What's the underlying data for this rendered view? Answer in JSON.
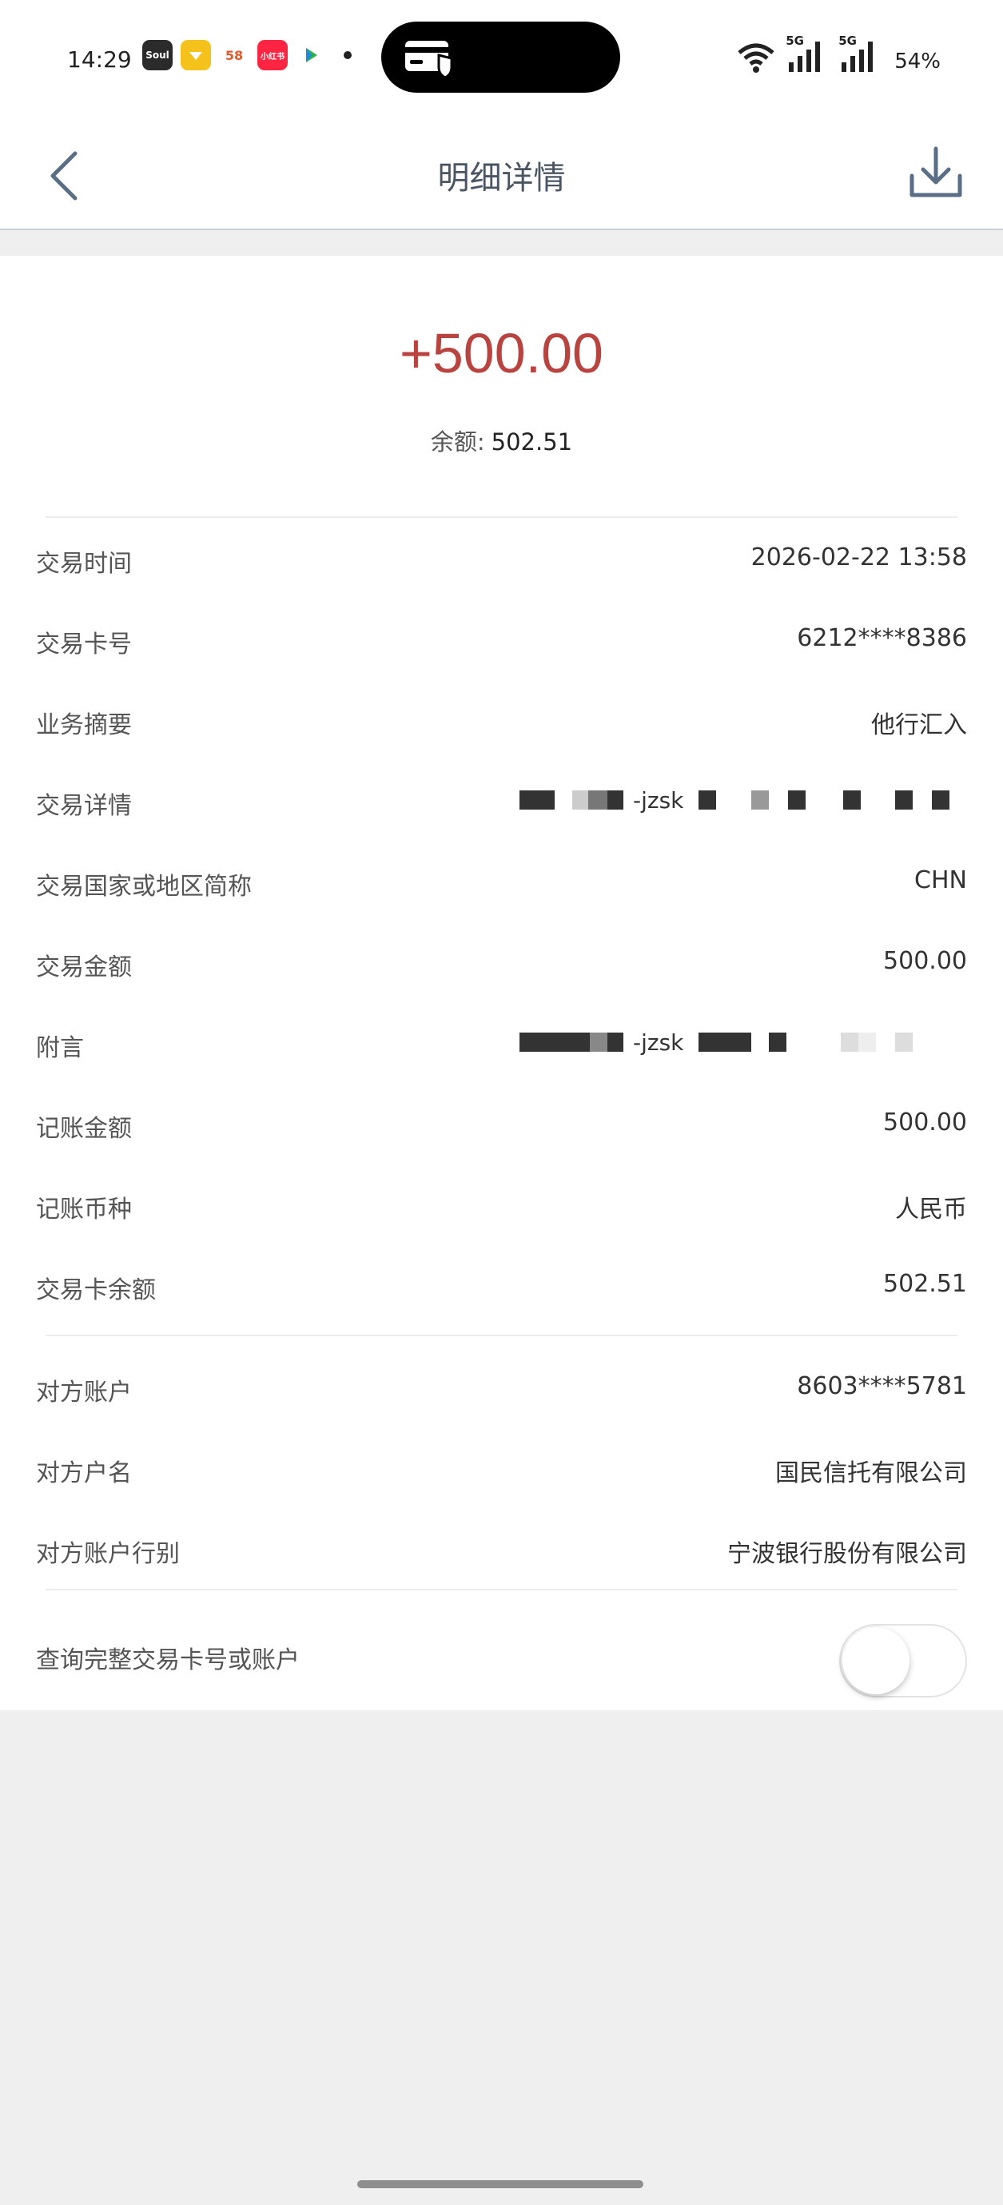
{
  "status_bar": {
    "time": "14:29",
    "notification_apps": [
      "Soul",
      "",
      "58",
      "小红书",
      ""
    ],
    "battery": "54%",
    "network_badges": [
      "5G",
      "5G"
    ]
  },
  "nav": {
    "title": "明细详情"
  },
  "summary": {
    "amount": "+500.00",
    "balance_label": "余额:",
    "balance_value": "502.51",
    "amount_color": "#b8433f"
  },
  "details": {
    "trade_time": {
      "label": "交易时间",
      "value": "2026-02-22  13:58"
    },
    "card_no": {
      "label": "交易卡号",
      "value": "6212****8386"
    },
    "summary": {
      "label": "业务摘要",
      "value": "他行汇入"
    },
    "trade_detail": {
      "label": "交易详情",
      "value_fragment": "-jzsk"
    },
    "country": {
      "label": "交易国家或地区简称",
      "value": "CHN"
    },
    "trade_amount": {
      "label": "交易金额",
      "value": "500.00"
    },
    "remark": {
      "label": "附言",
      "value_fragment": "-jzsk"
    },
    "book_amount": {
      "label": "记账金额",
      "value": "500.00"
    },
    "currency": {
      "label": "记账币种",
      "value": "人民币"
    },
    "card_balance": {
      "label": "交易卡余额",
      "value": "502.51"
    }
  },
  "counterparty": {
    "account": {
      "label": "对方账户",
      "value": "8603****5781"
    },
    "name": {
      "label": "对方户名",
      "value": "国民信托有限公司"
    },
    "bank": {
      "label": "对方账户行别",
      "value": "宁波银行股份有限公司"
    }
  },
  "full_number_toggle": {
    "label": "查询完整交易卡号或账户",
    "enabled": false
  }
}
